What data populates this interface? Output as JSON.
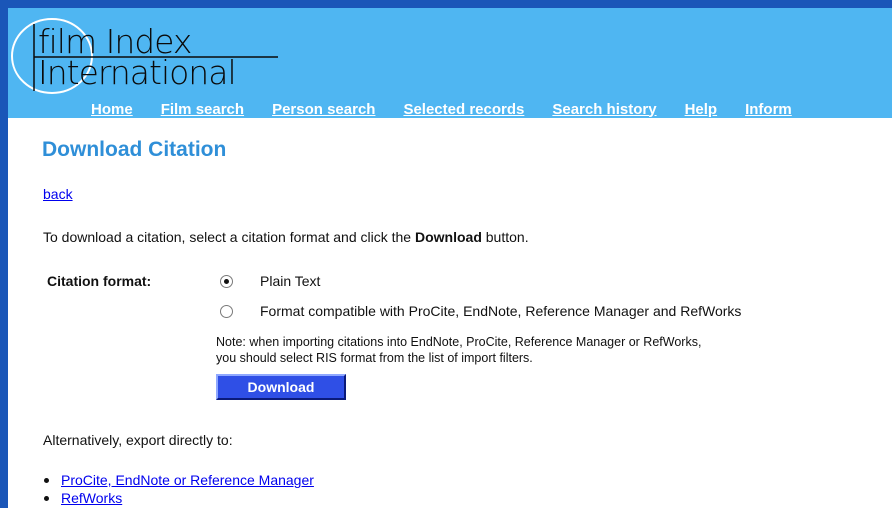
{
  "logo": {
    "line1": "film Index",
    "line2": "International"
  },
  "nav": {
    "items": [
      "Home",
      "Film search",
      "Person search",
      "Selected records",
      "Search history",
      "Help",
      "Inform"
    ]
  },
  "page": {
    "title": "Download Citation",
    "back_link": "back",
    "intro_prefix": "To download a citation, select a citation format and click the ",
    "intro_bold": "Download",
    "intro_suffix": " button."
  },
  "citation": {
    "label": "Citation format:",
    "options": [
      {
        "label": "Plain Text",
        "selected": true
      },
      {
        "label": "Format compatible with ProCite, EndNote, Reference Manager and RefWorks",
        "selected": false
      }
    ],
    "note_line1": "Note: when importing citations into EndNote, ProCite, Reference Manager or RefWorks,",
    "note_line2": "you should select RIS format from the list of import filters.",
    "download_label": "Download"
  },
  "export": {
    "heading": "Alternatively, export directly to:",
    "links": [
      "ProCite, EndNote or Reference Manager",
      "RefWorks"
    ]
  },
  "colors": {
    "frame": "#1a56b8",
    "banner": "#4fb6f2",
    "title": "#2f8fd8",
    "button": "#2f4fe6"
  }
}
